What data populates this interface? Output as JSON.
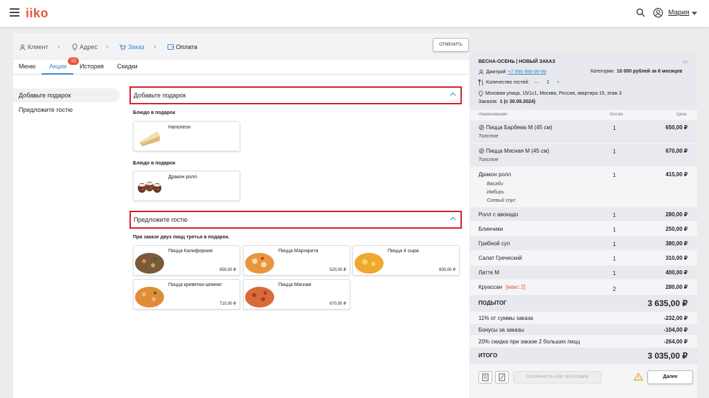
{
  "app": {
    "logo": "iiko",
    "user": "Мария"
  },
  "breadcrumbs": [
    "Клиент",
    "Адрес",
    "Заказ",
    "Оплата"
  ],
  "cancel_label": "ОТМЕНИТЬ",
  "tabs": [
    {
      "label": "Меню"
    },
    {
      "label": "Акции"
    },
    {
      "label": "История"
    },
    {
      "label": "Скидки"
    }
  ],
  "tab_badge": "12",
  "sidebar": [
    "Добавьте подарок",
    "Предложите гостю"
  ],
  "gift_section": {
    "title": "Добавьте подарок",
    "groups": [
      {
        "label": "Блюдо в подарок",
        "item": "Наполеон"
      },
      {
        "label": "Блюдо в подарок",
        "item": "Дракон ролл"
      }
    ]
  },
  "offer_section": {
    "title": "Предложите гостю",
    "note": "При заказе двух пицц третья в подарок.",
    "items": [
      {
        "name": "Пицца Калифорния",
        "price": "650,00 ₽"
      },
      {
        "name": "Пицца Маргарита",
        "price": "520,00 ₽"
      },
      {
        "name": "Пицца 4 сыра",
        "price": "600,00 ₽"
      },
      {
        "name": "Пицца креветки-шпинат",
        "price": "710,00 ₽"
      },
      {
        "name": "Пицца Мясная",
        "price": "670,00 ₽"
      }
    ]
  },
  "order": {
    "title": "ВЕСНА-ОСЕНЬ | НОВЫЙ ЗАКАЗ",
    "menu_dots": "-:-",
    "client": "Дмитрий",
    "phone": "+7 999 999-99-99",
    "category_label": "Категории:",
    "category_value": "10 000 рублей за 6 месяцев",
    "guests_label": "Количество гостей:",
    "guests": "1",
    "minus": "—",
    "plus": "+",
    "address": "Моховая улица, 15/1с1, Москва, Россия, квартира 15, этаж 3",
    "orders_label": "Заказов:",
    "orders_value": "1 (с 30.09.2024)",
    "col_name": "Наименование",
    "col_qty": "Кол-во",
    "col_price": "Цена",
    "items": [
      {
        "name": "Пицца Барбекю М (45 см)",
        "qty": "1",
        "price": "650,00 ₽",
        "mods": [
          "Толстое"
        ]
      },
      {
        "name": "Пицца Мясная М (45 см)",
        "qty": "1",
        "price": "670,00 ₽",
        "mods": [
          "Толстое"
        ]
      },
      {
        "name": "Дракон ролл",
        "qty": "1",
        "price": "415,00 ₽",
        "mods": [
          "Васаби",
          "Имбирь",
          "Соевый соус"
        ]
      },
      {
        "name": "Ролл с авокадо",
        "qty": "1",
        "price": "280,00 ₽",
        "mods": []
      },
      {
        "name": "Блинчики",
        "qty": "1",
        "price": "250,00 ₽",
        "mods": []
      },
      {
        "name": "Грибной суп",
        "qty": "1",
        "price": "380,00 ₽",
        "mods": []
      },
      {
        "name": "Салат Греческий",
        "qty": "1",
        "price": "310,00 ₽",
        "mods": []
      },
      {
        "name": "Латте М",
        "qty": "1",
        "price": "400,00 ₽",
        "mods": []
      },
      {
        "name": "Круассан",
        "qty": "2",
        "price": "280,00 ₽",
        "mods": [],
        "tag": "[макс 2]"
      }
    ],
    "subtotal_label": "ПОДЫТОГ",
    "subtotal": "3 635,00 ₽",
    "discounts": [
      {
        "label": "11% от суммы заказа",
        "value": "-232,00 ₽"
      },
      {
        "label": "Бонусы за заказы",
        "value": "-104,00 ₽"
      },
      {
        "label": "20% скидка при заказе 2 больших пицц",
        "value": "-264,00 ₽"
      }
    ],
    "total_label": "ИТОГО",
    "total": "3 035,00 ₽",
    "draft_label": "СОХРАНИТЬ КАК ЧЕРНОВИК",
    "next_label": "Далее"
  },
  "colors": {
    "accent": "#3a86c8",
    "brand": "#e5573d",
    "highlight": "#d0202a"
  }
}
